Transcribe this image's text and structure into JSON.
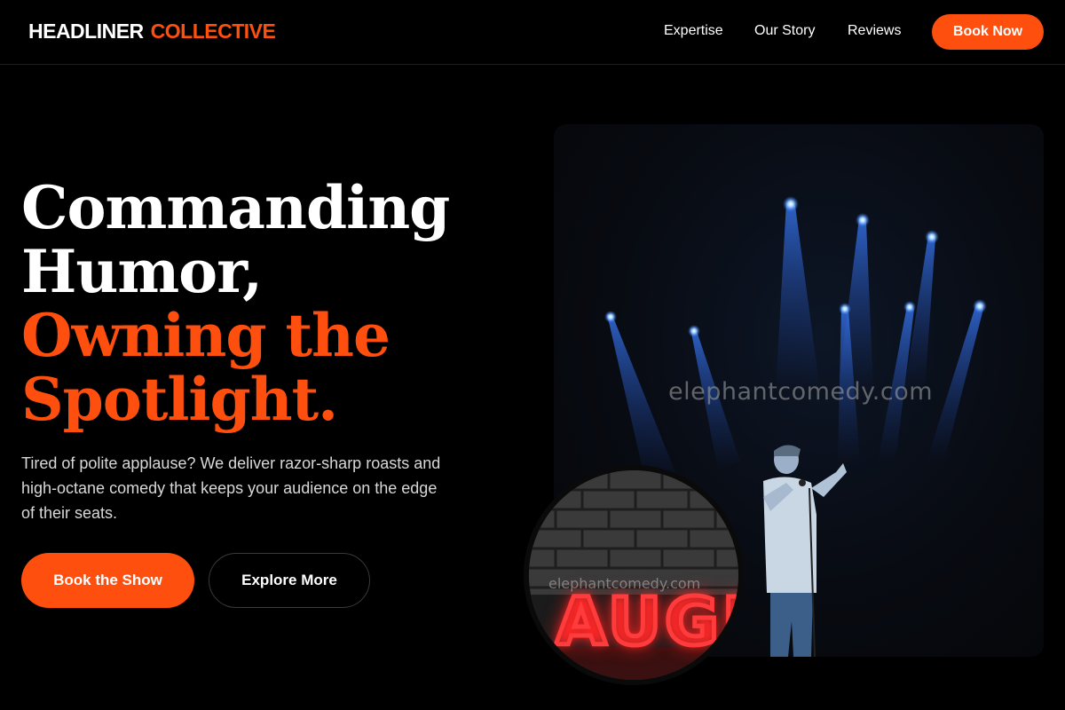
{
  "header": {
    "logo_primary": "HEADLINER",
    "logo_accent": "COLLECTIVE",
    "nav": [
      "Expertise",
      "Our Story",
      "Reviews"
    ],
    "cta": "Book Now"
  },
  "hero": {
    "headline_lines": [
      "Commanding",
      "Humor,"
    ],
    "headline_accent_lines": [
      "Owning the",
      "Spotlight."
    ],
    "subtext": "Tired of polite applause? We deliver razor-sharp roasts and high-octane comedy that keeps your audience on the edge of their seats.",
    "primary_button": "Book the Show",
    "secondary_button": "Explore More"
  },
  "media": {
    "main_watermark": "elephantcomedy.com",
    "inset_watermark": "elephantcomedy.com",
    "inset_sign": "AUGI"
  },
  "colors": {
    "accent": "#ff4f0f",
    "background": "#000000",
    "text": "#ffffff",
    "subtext": "#d8d8d8"
  }
}
